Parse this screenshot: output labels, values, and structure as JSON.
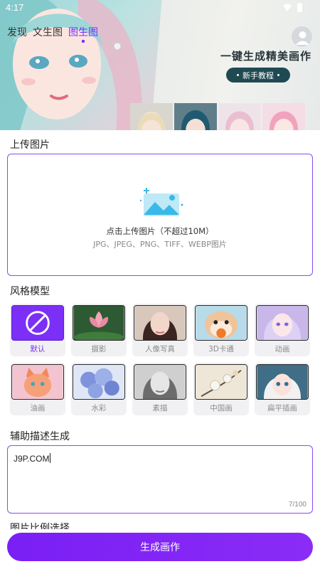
{
  "status": {
    "time": "4:17"
  },
  "tabs": [
    {
      "label": "发现",
      "active": false
    },
    {
      "label": "文生图",
      "active": false
    },
    {
      "label": "图生图",
      "active": true
    }
  ],
  "banner": {
    "slogan": "一键生成精美画作",
    "tutorial_label": "新手教程"
  },
  "upload": {
    "title": "上传图片",
    "hint": "点击上传图片（不超过10M）",
    "formats": "JPG、JPEG、PNG、TIFF、WEBP图片"
  },
  "styles": {
    "title": "风格模型",
    "items": [
      {
        "label": "默认",
        "selected": true
      },
      {
        "label": "摄影",
        "selected": false
      },
      {
        "label": "人像写真",
        "selected": false
      },
      {
        "label": "3D卡通",
        "selected": false
      },
      {
        "label": "动画",
        "selected": false
      },
      {
        "label": "油画",
        "selected": false
      },
      {
        "label": "水彩",
        "selected": false
      },
      {
        "label": "素描",
        "selected": false
      },
      {
        "label": "中国画",
        "selected": false
      },
      {
        "label": "扁平插画",
        "selected": false
      }
    ]
  },
  "description": {
    "title": "辅助描述生成",
    "value": "J9P.COM",
    "counter": "7/100"
  },
  "ratio": {
    "title": "图片比例选择"
  },
  "generate": {
    "label": "生成画作"
  },
  "colors": {
    "accent": "#7b2ff7",
    "tutorial_bg": "#1f4a52"
  }
}
